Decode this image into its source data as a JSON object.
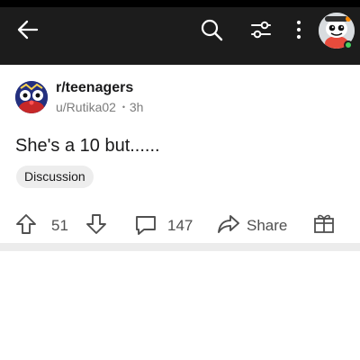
{
  "header": {
    "back_icon": "arrow-left-icon",
    "search_icon": "search-icon",
    "filter_icon": "sliders-icon",
    "more_icon": "vertical-ellipsis-icon",
    "avatar_icon": "snoo-avatar-icon",
    "online_status_color": "#46d160"
  },
  "post": {
    "subreddit": "r/teenagers",
    "author": "u/Rutika02",
    "separator": "•",
    "age": "3h",
    "title": "She's a 10 but......",
    "flair": "Discussion",
    "votes": "51",
    "comments": "147",
    "share_label": "Share",
    "award_icon": "gift-icon"
  },
  "colors": {
    "topbar": "#1c1c1c",
    "text": "#1a1a1b",
    "muted": "#7c7c7c",
    "flair_bg": "#ededed",
    "divider": "#ececec"
  }
}
